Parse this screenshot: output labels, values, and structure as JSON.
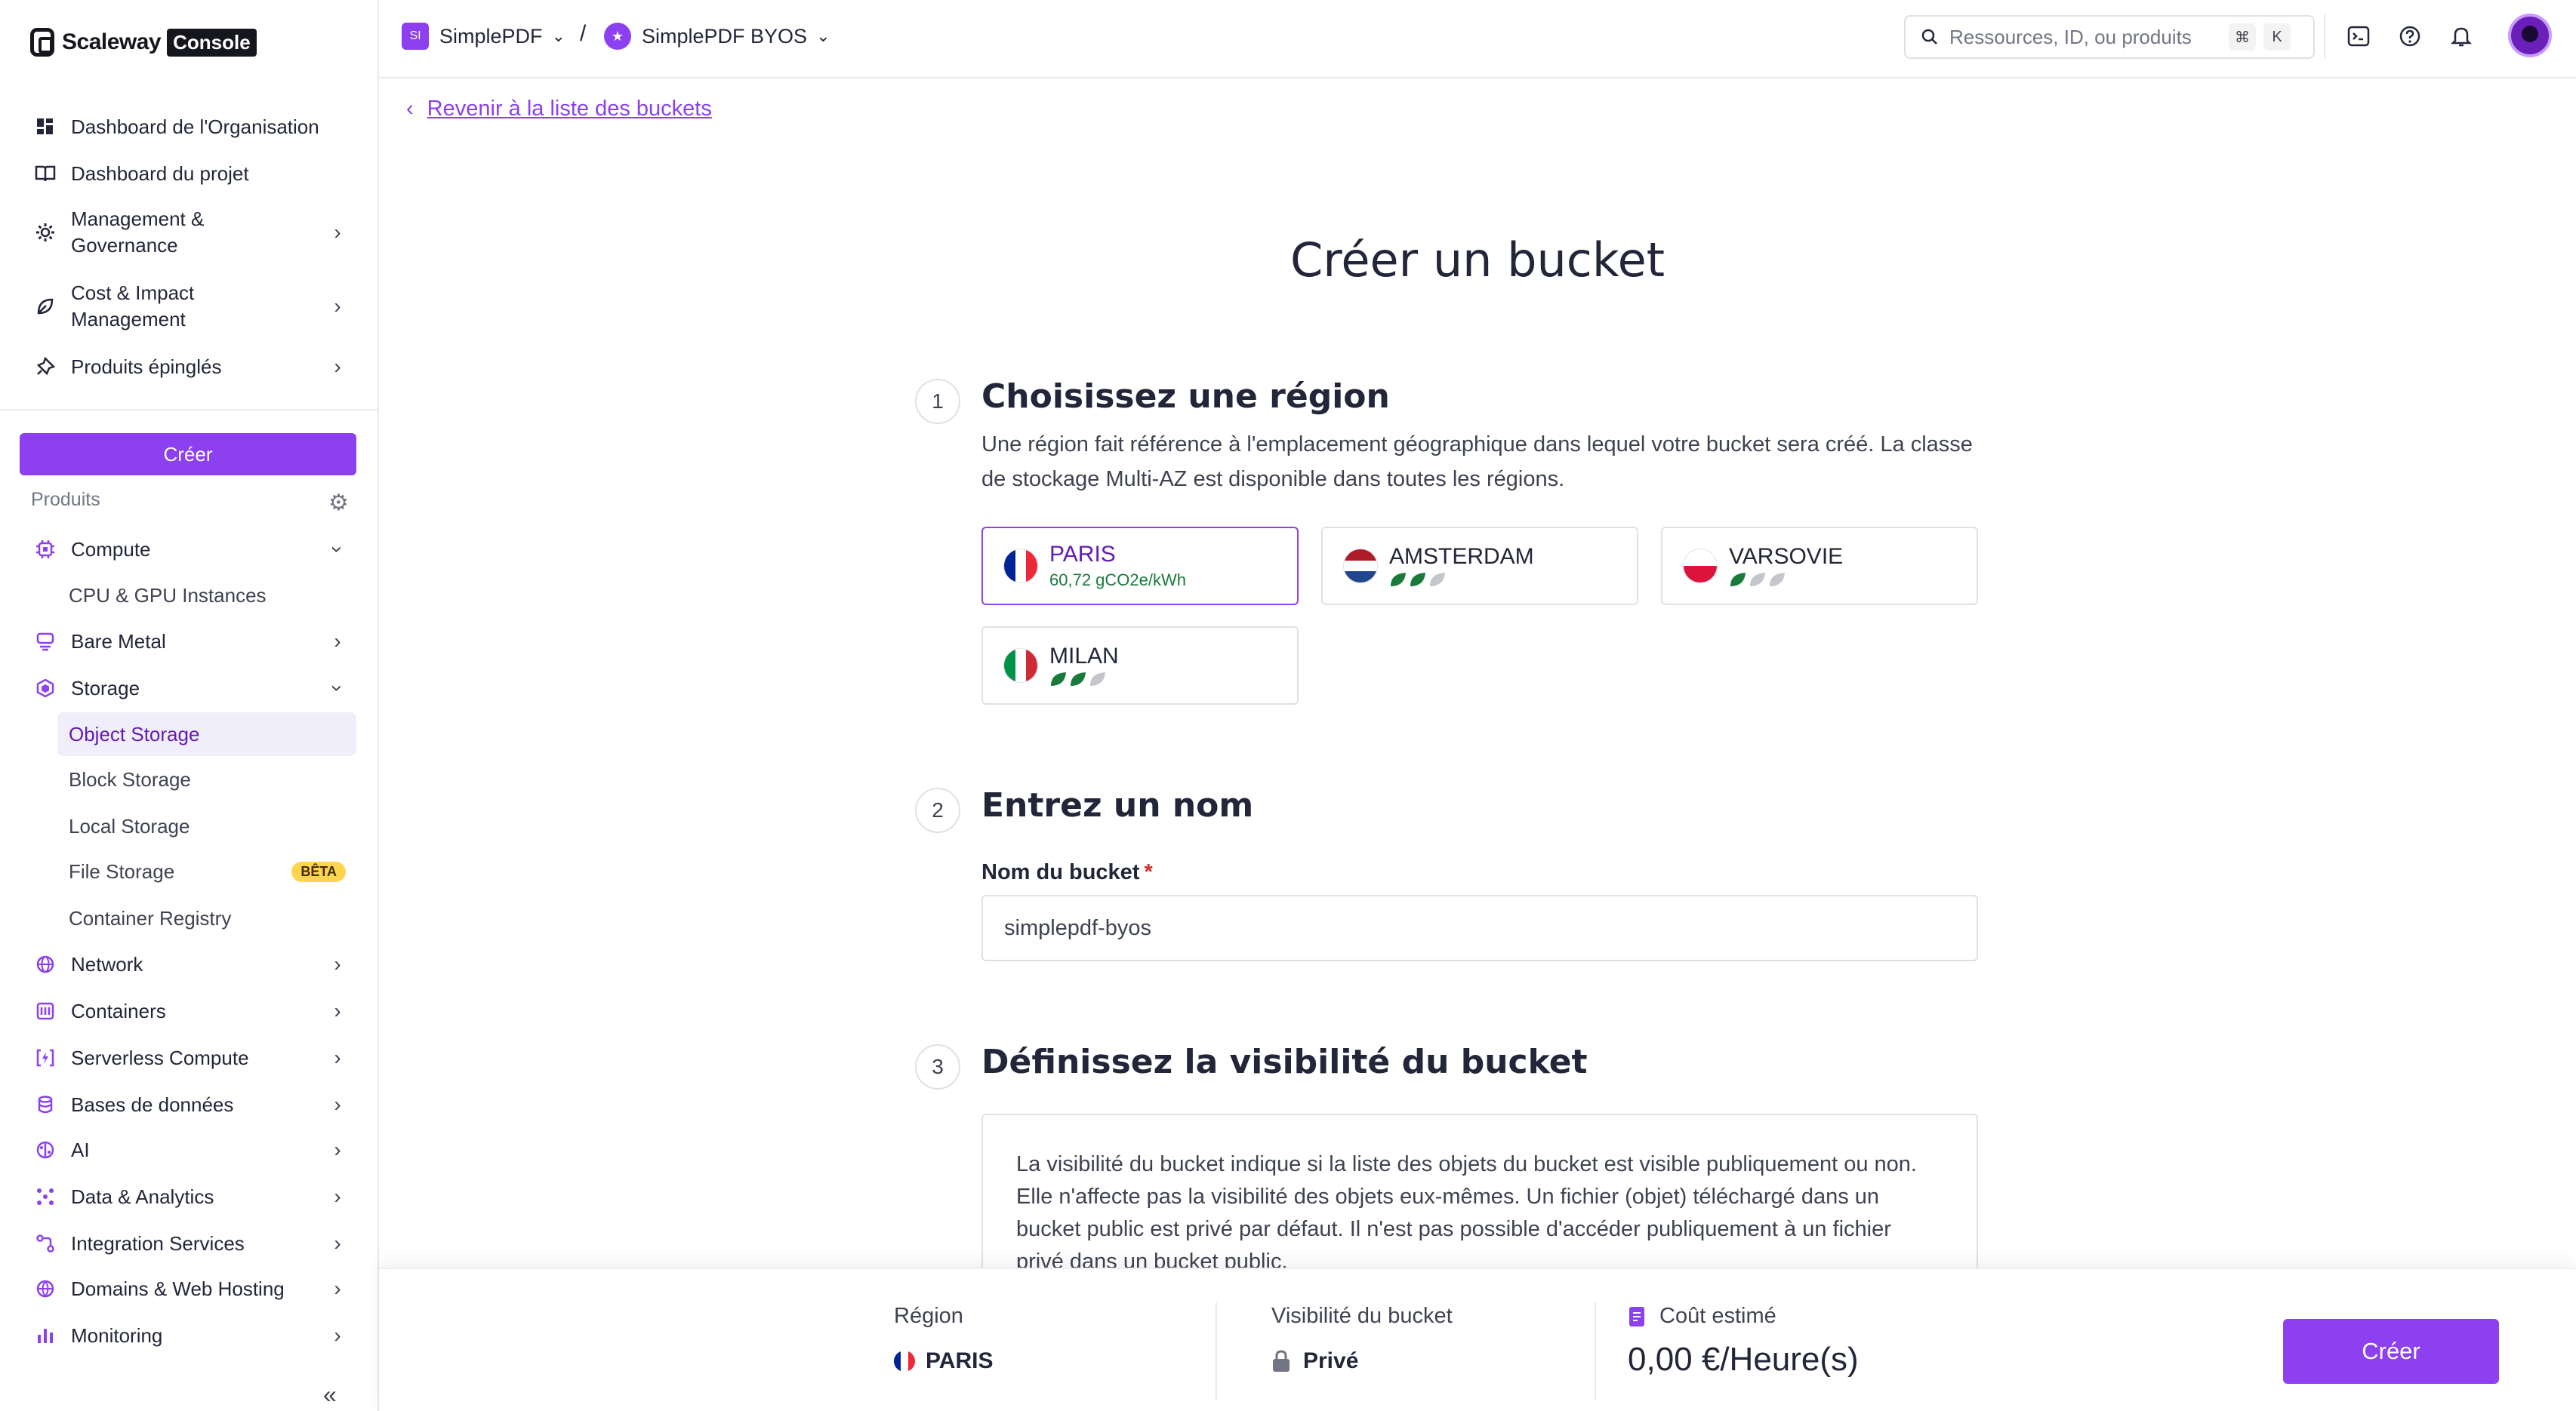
{
  "app": {
    "logo_text": "Scaleway",
    "logo_badge": "Console"
  },
  "colors": {
    "accent": "#8c40ef",
    "accent_dark": "#641cb3",
    "text": "#222638",
    "border": "#e0e1e5",
    "eco_green": "#1a7a3c"
  },
  "sidebar": {
    "top_items": [
      {
        "label": "Dashboard de l'Organisation",
        "icon": "org-dashboard-icon"
      },
      {
        "label": "Dashboard du projet",
        "icon": "book-icon"
      },
      {
        "label": "Management & Governance",
        "icon": "gear-icon"
      },
      {
        "label": "Cost & Impact Management",
        "icon": "leaf-icon"
      },
      {
        "label": "Produits épinglés",
        "icon": "pin-icon"
      }
    ],
    "create_label": "Créer",
    "products_label": "Produits",
    "products": [
      {
        "label": "Compute",
        "icon": "chip-icon"
      },
      {
        "label": "CPU & GPU Instances"
      },
      {
        "label": "Bare Metal",
        "icon": "server-icon"
      },
      {
        "label": "Storage",
        "icon": "hexagon-icon"
      },
      {
        "label": "Object Storage"
      },
      {
        "label": "Block Storage"
      },
      {
        "label": "Local Storage"
      },
      {
        "label": "File Storage",
        "badge": "BÊTA"
      },
      {
        "label": "Container Registry"
      },
      {
        "label": "Network",
        "icon": "globe-icon"
      },
      {
        "label": "Containers",
        "icon": "container-icon"
      },
      {
        "label": "Serverless Compute",
        "icon": "serverless-icon"
      },
      {
        "label": "Bases de données",
        "icon": "database-icon"
      },
      {
        "label": "AI",
        "icon": "ai-icon"
      },
      {
        "label": "Data & Analytics",
        "icon": "analytics-icon"
      },
      {
        "label": "Integration Services",
        "icon": "integration-icon"
      },
      {
        "label": "Domains & Web Hosting",
        "icon": "domains-icon"
      },
      {
        "label": "Monitoring",
        "icon": "monitoring-icon"
      }
    ]
  },
  "topbar": {
    "org_badge": "SI",
    "org_name": "SimplePDF",
    "separator": "/",
    "project_name": "SimplePDF BYOS",
    "search_placeholder": "Ressources, ID, ou produits",
    "shortcut_keys": [
      "⌘",
      "K"
    ]
  },
  "main": {
    "back_label": "Revenir à la liste des buckets",
    "title": "Créer un bucket",
    "step1": {
      "num": "1",
      "title": "Choisissez une région",
      "description": "Une région fait référence à l'emplacement géographique dans lequel votre bucket sera créé. La classe de stockage Multi-AZ est disponible dans toutes les régions.",
      "regions": [
        {
          "name": "PARIS",
          "co2": "60,72 gCO2e/kWh",
          "selected": true,
          "eco_level": 3
        },
        {
          "name": "AMSTERDAM",
          "eco_level": 2
        },
        {
          "name": "VARSOVIE",
          "eco_level": 1
        },
        {
          "name": "MILAN",
          "eco_level": 2
        }
      ]
    },
    "step2": {
      "num": "2",
      "title": "Entrez un nom",
      "field_label": "Nom du bucket",
      "required_mark": "*",
      "value": "simplepdf-byos"
    },
    "step3": {
      "num": "3",
      "title": "Définissez la visibilité du bucket",
      "description": "La visibilité du bucket indique si la liste des objets du bucket est visible publiquement ou non. Elle n'affecte pas la visibilité des objets eux-mêmes. Un fichier (objet) téléchargé dans un bucket public est privé par défaut. Il n'est pas possible d'accéder publiquement à un fichier privé dans un bucket public."
    }
  },
  "summary": {
    "region_label": "Région",
    "region_value": "PARIS",
    "visibility_label": "Visibilité du bucket",
    "visibility_value": "Privé",
    "cost_label": "Coût estimé",
    "cost_value": "0,00 €/Heure(s)",
    "create_label": "Créer"
  }
}
